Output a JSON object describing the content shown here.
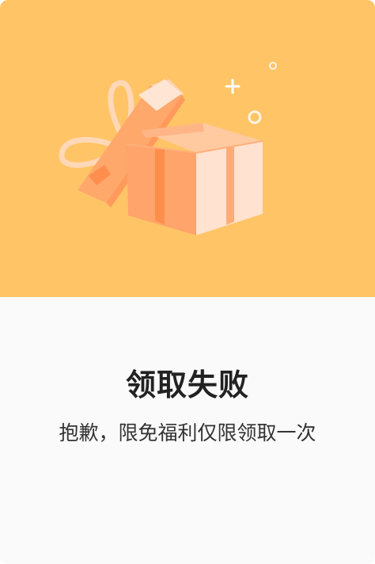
{
  "dialog": {
    "title": "领取失败",
    "message": "抱歉，限免福利仅限领取一次",
    "hero_illustration": "open-gift-box-icon",
    "colors": {
      "hero_background": "#ffc466",
      "body_background": "#fafafa",
      "title_text": "#222222",
      "message_text": "#333333"
    }
  }
}
